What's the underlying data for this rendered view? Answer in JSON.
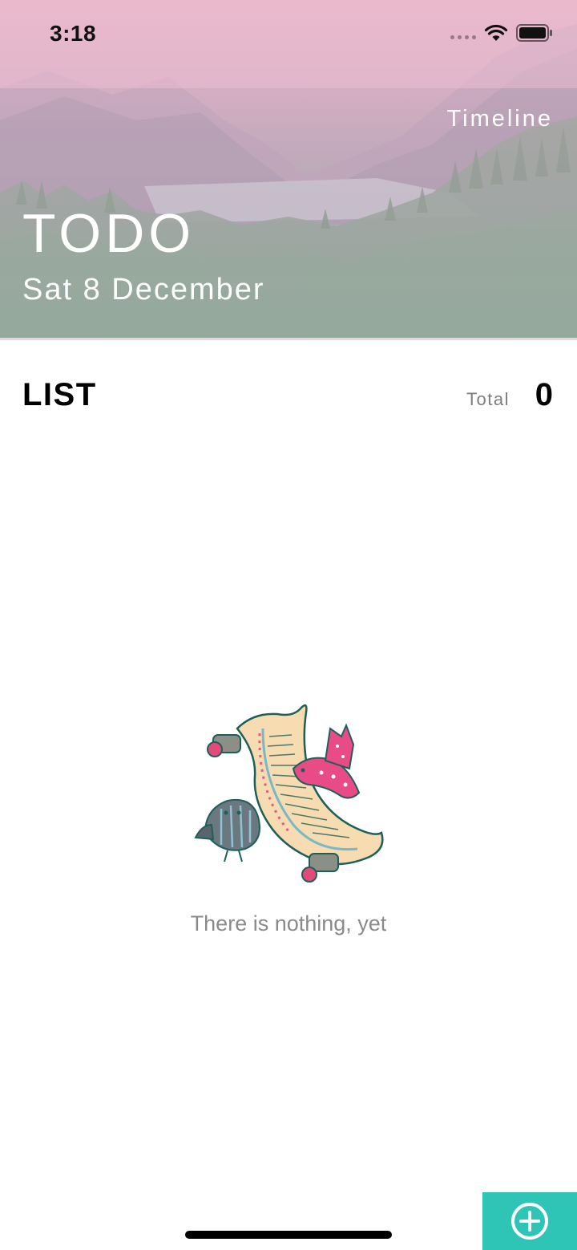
{
  "status_bar": {
    "time": "3:18",
    "signal_icon": "cellular-signal-icon",
    "wifi_icon": "wifi-icon",
    "battery_icon": "battery-icon"
  },
  "header": {
    "timeline_label": "Timeline",
    "title": "TODO",
    "date": "Sat 8 December",
    "background": "mountain-lake-landscape"
  },
  "list": {
    "title": "LIST",
    "total_label": "Total",
    "total_count": "0"
  },
  "empty_state": {
    "illustration": "scroll-with-birds-illustration",
    "message": "There is nothing, yet"
  },
  "fab": {
    "icon": "plus-circle-icon",
    "color": "#2ec4b6"
  }
}
